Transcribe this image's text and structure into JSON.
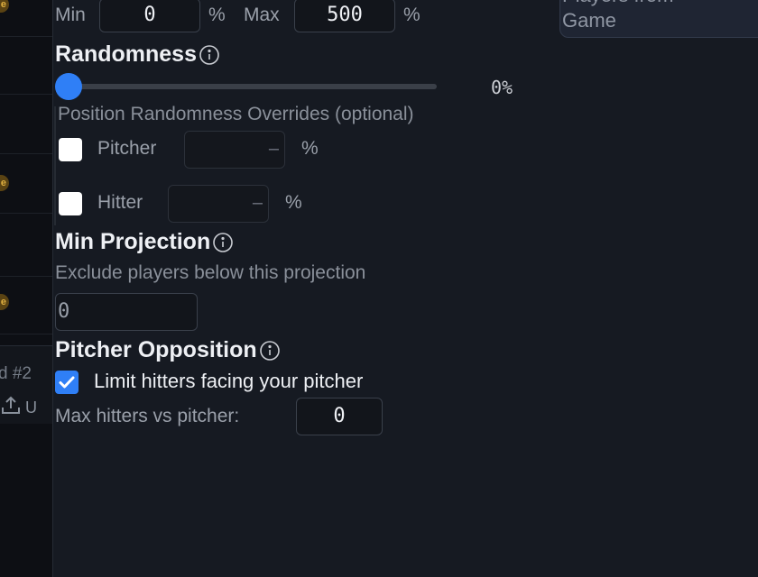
{
  "left_rail": {
    "badges": [
      "e",
      "e",
      "e"
    ],
    "section_label": "d #2",
    "upload_label": "U"
  },
  "range": {
    "min_label": "Min",
    "min_value": "0",
    "min_unit": "%",
    "max_label": "Max",
    "max_value": "500",
    "max_unit": "%"
  },
  "randomness": {
    "title": "Randomness",
    "info_icon": "info-circle-icon",
    "slider_value": "0%",
    "slider_fraction": 0,
    "overrides_label": "Position Randomness Overrides (optional)",
    "overrides": [
      {
        "label": "Pitcher",
        "value": "",
        "unit": "%",
        "checked": false
      },
      {
        "label": "Hitter",
        "value": "",
        "unit": "%",
        "checked": false
      }
    ]
  },
  "min_projection": {
    "title": "Min Projection",
    "description": "Exclude players below this projection",
    "value": "0"
  },
  "pitcher_opposition": {
    "title": "Pitcher Opposition",
    "limit_label": "Limit hitters facing your pitcher",
    "limit_checked": true,
    "max_label": "Max hitters vs pitcher:",
    "max_value": "0"
  },
  "right_card": {
    "title_line1": "Players from",
    "title_line2": "Game",
    "extra": "m"
  },
  "colors": {
    "background": "#161a22",
    "accent": "#2f7ff6",
    "badge": "#e0b040"
  }
}
